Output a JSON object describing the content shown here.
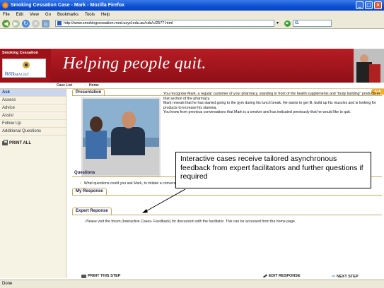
{
  "window": {
    "title": "Smoking Cessation Case - Mark - Mozilla Firefox",
    "controls": [
      "_",
      "□",
      "×"
    ]
  },
  "menu": [
    "File",
    "Edit",
    "View",
    "Go",
    "Bookmarks",
    "Tools",
    "Help"
  ],
  "address": {
    "url": "http://www.smokingcessation.med.usyd.edu.au/cds/c/2577.html",
    "search_value": "G."
  },
  "banner": {
    "logo_title": "Smoking Cessation",
    "logo_sub_small": "for your",
    "logo_sub": "PHARMACIST",
    "tagline": "Helping people quit."
  },
  "breadcrumb": [
    "Case List",
    "Home"
  ],
  "sidebar": {
    "items": [
      "Ask",
      "Assess",
      "Advice",
      "Assist",
      "Follow Up",
      "Additional Questions"
    ],
    "active_index": 0,
    "print_all": "PRINT ALL"
  },
  "content": {
    "ask_badge": "Ask",
    "presentation_title": "Presentation",
    "presentation_paragraphs": [
      "You recognise Mark, a regular customer of your pharmacy, standing in front of the health supplements and \"body building\" products in that section of the pharmacy.",
      "Mark reveals that he has started going to the gym during his lunch break. He wants to get fit, build up his muscles and is looking for products to increase his stamina.",
      "You know from previous conversations that Mark is a smoker and has indicated previously that he would like to quit."
    ],
    "questions_title": "Questions",
    "question_text": "What questions could you ask Mark, to initiate a conversation about his smoking?",
    "my_response_title": "My Response",
    "expert_title": "Expert Reponse",
    "expert_text": "Please visit the forum (Interactive Cases- Feedback) for discussion with the facilitator. This can be accessed from the home page."
  },
  "actions": {
    "print_step": "PRINT THIS STEP",
    "edit_response": "EDIT RESPONSE",
    "next_step": "NEXT STEP"
  },
  "annotation": {
    "text": "Interactive cases receive tailored asynchronous feedback from expert facilitators and further questions if required"
  },
  "status": {
    "text": "Done"
  }
}
